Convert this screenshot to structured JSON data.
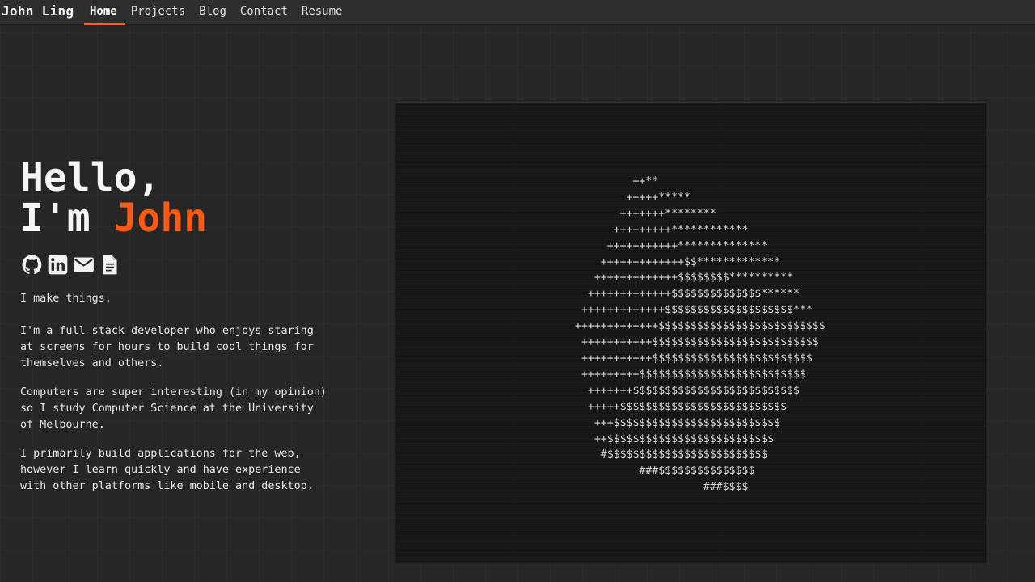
{
  "nav": {
    "brand": "John Ling",
    "links": [
      "Home",
      "Projects",
      "Blog",
      "Contact",
      "Resume"
    ],
    "active": "Home"
  },
  "hero": {
    "greeting": "Hello,",
    "im": "I'm ",
    "name": "John"
  },
  "socials": [
    {
      "icon": "github-icon"
    },
    {
      "icon": "linkedin-icon"
    },
    {
      "icon": "email-icon"
    },
    {
      "icon": "resume-document-icon"
    }
  ],
  "bio": {
    "tagline": "I make things.",
    "p1": "I'm a full-stack developer who enjoys staring at screens for hours to build cool things for themselves and others.",
    "p2": "Computers are super interesting (in my opinion) so I study Computer Science at the University of Melbourne.",
    "p3": "I primarily build applications for the web, however I learn quickly and have experience with other platforms like mobile and desktop."
  },
  "ascii_art": "         ++**\n        +++++*****\n       +++++++********\n      +++++++++************\n     +++++++++++**************\n    +++++++++++++$$*************\n   +++++++++++++$$$$$$$$**********\n  +++++++++++++$$$$$$$$$$$$$$******\n +++++++++++++$$$$$$$$$$$$$$$$$$$$***\n+++++++++++++$$$$$$$$$$$$$$$$$$$$$$$$$$\n +++++++++++$$$$$$$$$$$$$$$$$$$$$$$$$$\n +++++++++++$$$$$$$$$$$$$$$$$$$$$$$$$\n +++++++++$$$$$$$$$$$$$$$$$$$$$$$$$$\n  +++++++$$$$$$$$$$$$$$$$$$$$$$$$$$\n  +++++$$$$$$$$$$$$$$$$$$$$$$$$$$\n   +++$$$$$$$$$$$$$$$$$$$$$$$$$$\n   ++$$$$$$$$$$$$$$$$$$$$$$$$$$\n    #$$$$$$$$$$$$$$$$$$$$$$$$$\n          ###$$$$$$$$$$$$$$$\n                    ###$$$$",
  "colors": {
    "accent": "#ff5a14",
    "background": "#262626",
    "navbar": "#2e2e2e",
    "panel": "#161616"
  }
}
